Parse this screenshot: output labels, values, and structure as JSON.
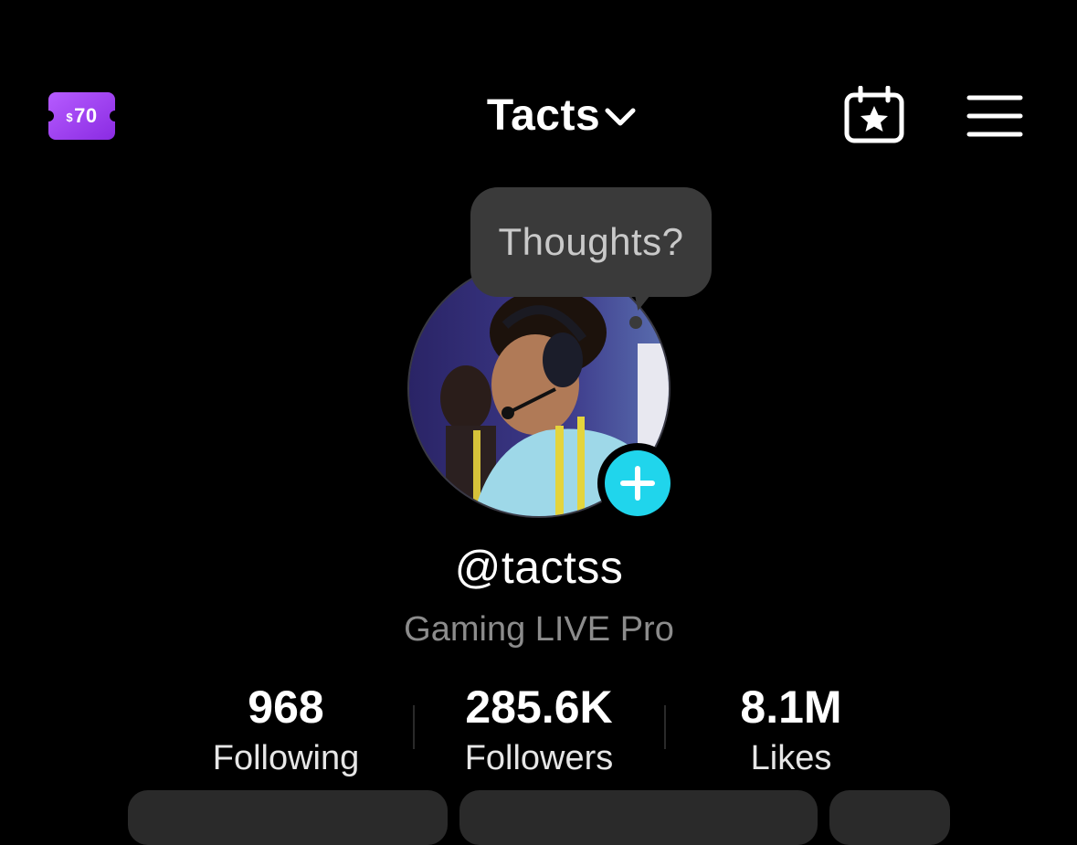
{
  "header": {
    "coupon": {
      "currency": "$",
      "amount": "70"
    },
    "account_name": "Tacts",
    "icons": {
      "account_switch": "chevron-down-icon",
      "calendar": "calendar-star-icon",
      "menu": "hamburger-menu-icon"
    }
  },
  "profile": {
    "note_bubble": "Thoughts?",
    "username": "@tactss",
    "subtitle": "Gaming LIVE Pro"
  },
  "stats": [
    {
      "value": "968",
      "label": "Following"
    },
    {
      "value": "285.6K",
      "label": "Followers"
    },
    {
      "value": "8.1M",
      "label": "Likes"
    }
  ],
  "colors": {
    "background": "#000000",
    "accent_cyan": "#20d5ec",
    "coupon_purple": "#9b3dff",
    "bubble_gray": "#3a3a3a",
    "subtitle_gray": "#8c8c8c"
  }
}
